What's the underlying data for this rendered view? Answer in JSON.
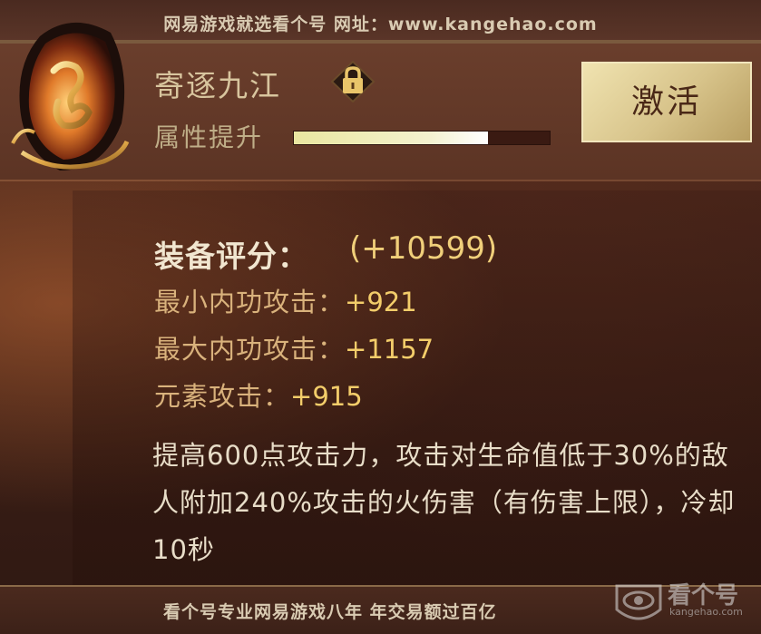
{
  "watermark": {
    "top": "网易游戏就选看个号  网址：www.kangehao.com",
    "bottom": "看个号专业网易游戏八年  年交易额过百亿",
    "logo_text": "看个号",
    "logo_sub": "kangehao.com"
  },
  "item": {
    "name": "寄逐九江",
    "locked": true,
    "attr_label": "属性提升",
    "attr_progress": 0.76
  },
  "activate_button": {
    "label": "激活"
  },
  "score": {
    "label": "装备评分：",
    "value": "(+10599)"
  },
  "stats": [
    {
      "label": "最小内功攻击：",
      "value": "+921"
    },
    {
      "label": "最大内功攻击：",
      "value": "+1157"
    },
    {
      "label": "元素攻击：",
      "value": "+915"
    }
  ],
  "description": "提高600点攻击力，攻击对生命值低于30%的敌人附加240%攻击的火伤害（有伤害上限），冷却10秒",
  "colors": {
    "title": "#d8c59e",
    "stat_value": "#f3cd6a",
    "button_bg": "#d7c38a"
  },
  "icons": {
    "emblem": "flame-crest-icon",
    "lock": "lock-icon"
  }
}
